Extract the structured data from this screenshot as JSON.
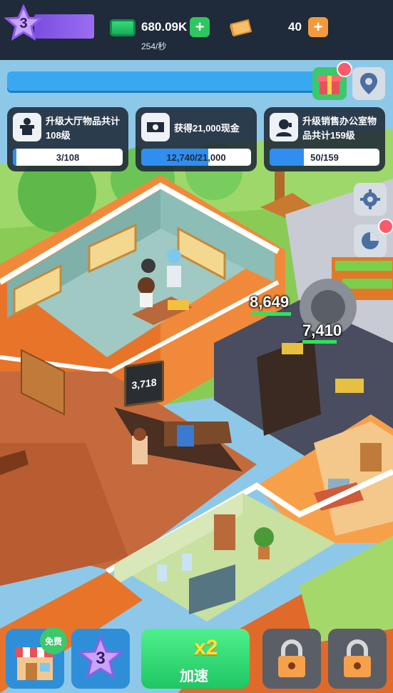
{
  "header": {
    "level": "3",
    "cash": "680.09K",
    "cash_rate": "254/秒",
    "gold": "40"
  },
  "tasks": [
    {
      "text": "升级大厅物品共计108级",
      "count": "3/108",
      "progress": 0.03,
      "icon": "upgrade-pedestal-icon"
    },
    {
      "text": "获得21,000现金",
      "count": "12,740/21,000",
      "progress": 0.61,
      "icon": "cash-stack-icon"
    },
    {
      "text": "升级销售办公室物品共计159级",
      "count": "50/159",
      "progress": 0.31,
      "icon": "sales-agent-icon"
    }
  ],
  "scene": {
    "counter_a": "8,649",
    "counter_b": "7,410",
    "sign": "3,718"
  },
  "bottom": {
    "free_label": "免费",
    "star_level": "3",
    "speed_multiplier": "x2",
    "speed_label": "加速"
  },
  "colors": {
    "topbar": "#1f2a3a",
    "cash_green": "#2dc65f",
    "gold_orange": "#f59a3c",
    "progress_blue": "#2f8ef0",
    "wall_orange": "#e8742a"
  }
}
